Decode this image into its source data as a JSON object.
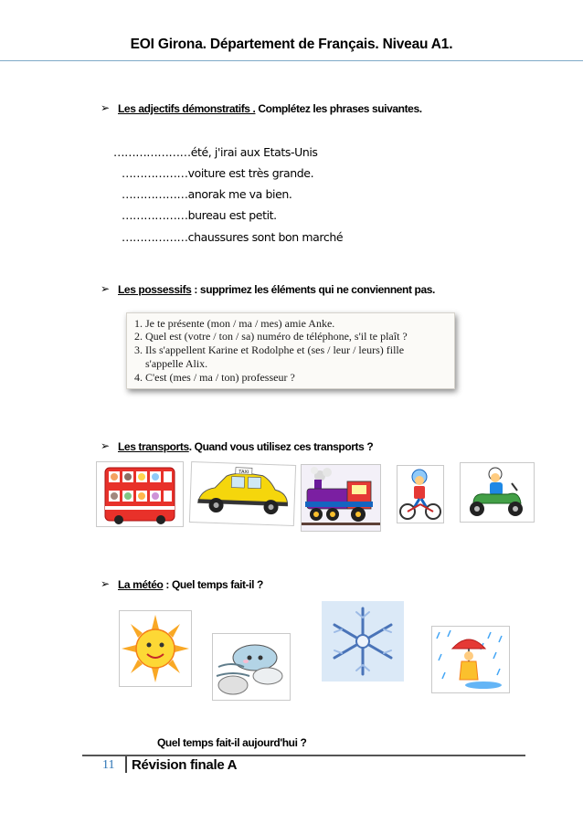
{
  "header": {
    "title": "EOI Girona. Département de Français. Niveau A1."
  },
  "bullet_glyph": "➢",
  "section1": {
    "label_underlined": "Les adjectifs démonstratifs .",
    "label_rest": " Complétez les phrases suivantes.",
    "lines": [
      "…………………été,  j'irai  aux  Etats-Unis",
      "………………voiture  est  très  grande.",
      "………………anorak  me  va  bien.",
      "………………bureau  est  petit.",
      "………………chaussures  sont  bon  marché"
    ]
  },
  "section2": {
    "label_underlined": "Les possessifs",
    "label_rest": " : supprimez les éléments qui ne conviennent pas.",
    "items": [
      "1. Je te présente (mon / ma / mes) amie Anke.",
      "2. Quel est (votre / ton / sa) numéro de téléphone, s'il te plaît ?",
      "3. Ils s'appellent Karine et Rodolphe et (ses / leur / leurs) fille",
      "    s'appelle Alix.",
      "4. C'est (mes / ma / ton) professeur ?"
    ]
  },
  "section3": {
    "label_underlined": "Les transports",
    "label_rest": ". Quand  vous utilisez ces transports ?",
    "taxi_sign": "TAXI"
  },
  "section4": {
    "label_underlined": "La météo",
    "label_rest": " : Quel temps fait-il ?",
    "question": "Quel temps fait-il aujourd'hui ?"
  },
  "footer": {
    "page_number": "11",
    "title": "Révision finale A"
  },
  "colors": {
    "header_rule": "#7faac8",
    "page_number": "#2e75b6",
    "bus_red": "#e8312a",
    "taxi_yellow": "#f5d60c"
  }
}
